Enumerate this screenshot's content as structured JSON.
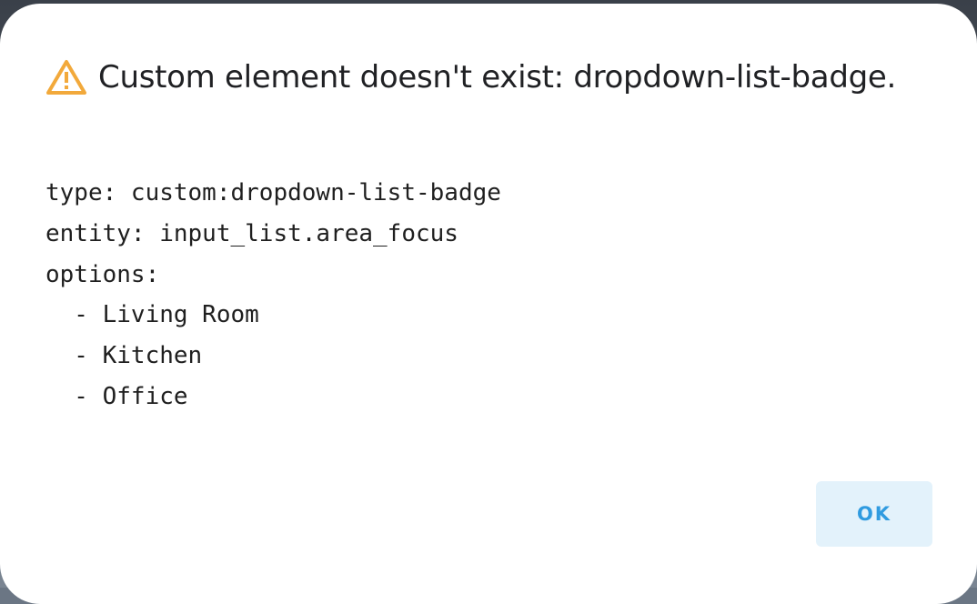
{
  "dialog": {
    "title": "Custom element doesn't exist: dropdown-list-badge.",
    "icon": "warning-triangle-icon",
    "icon_color": "#f2a93b",
    "config_lines": [
      "type: custom:dropdown-list-badge",
      "entity: input_list.area_focus",
      "options:",
      "  - Living Room",
      "  - Kitchen",
      "  - Office"
    ],
    "ok_label": "OK",
    "accent_color": "#2f9be0"
  }
}
